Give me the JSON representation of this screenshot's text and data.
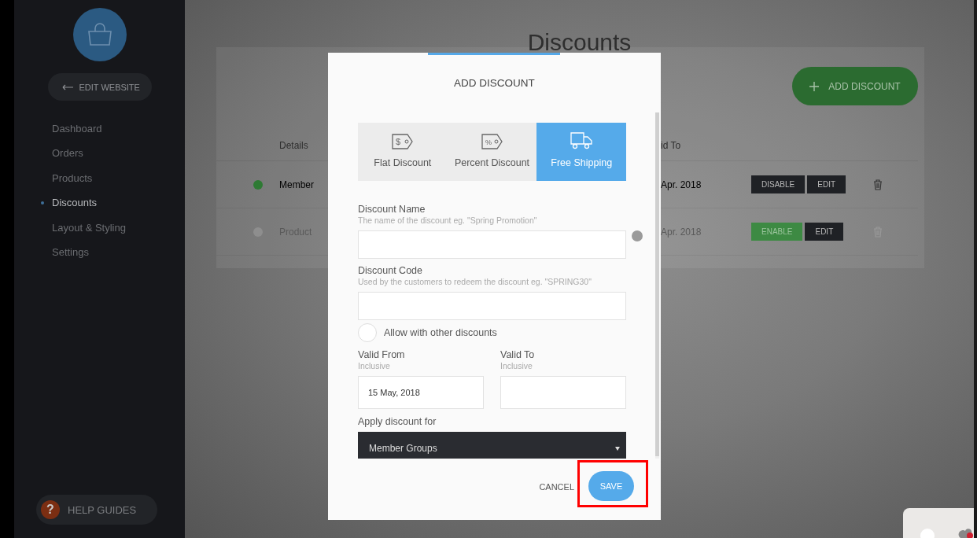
{
  "sidebar": {
    "edit_button": {
      "label": "EDIT WEBSITE"
    },
    "items": [
      {
        "label": "Dashboard",
        "selected": false
      },
      {
        "label": "Orders",
        "selected": false
      },
      {
        "label": "Products",
        "selected": false
      },
      {
        "label": "Discounts",
        "selected": true
      },
      {
        "label": "Layout & Styling",
        "selected": false
      },
      {
        "label": "Settings",
        "selected": false
      }
    ],
    "help": {
      "icon": "?",
      "label": "HELP GUIDES"
    }
  },
  "page": {
    "title": "Discounts",
    "add_button": {
      "label": "ADD DISCOUNT"
    },
    "columns": [
      "Details",
      "id To"
    ],
    "rows": [
      {
        "enabled": true,
        "details": "Member",
        "valid_to": "Apr. 2018",
        "toggle": "DISABLE",
        "edit": "EDIT"
      },
      {
        "enabled": false,
        "details": "Product",
        "valid_to": "Apr. 2018",
        "toggle": "ENABLE",
        "edit": "EDIT"
      }
    ]
  },
  "dialog": {
    "title": "ADD DISCOUNT",
    "types": [
      {
        "kind": "flat",
        "symbol": "$",
        "label": "Flat Discount",
        "selected": false
      },
      {
        "kind": "percent",
        "symbol": "%",
        "label": "Percent Discount",
        "selected": false
      },
      {
        "kind": "shipping",
        "label": "Free Shipping",
        "selected": true
      }
    ],
    "name_field": {
      "label": "Discount Name",
      "hint": "The name of the discount eg. \"Spring Promotion\""
    },
    "code_field": {
      "label": "Discount Code",
      "hint": "Used by the customers to redeem the discount eg. \"SPRING30\""
    },
    "allow_other": {
      "label": "Allow with other discounts",
      "checked": false
    },
    "valid_from": {
      "label": "Valid From",
      "hint": "Inclusive",
      "value": "15 May, 2018"
    },
    "valid_to": {
      "label": "Valid To",
      "hint": "Inclusive"
    },
    "apply_for": {
      "label": "Apply discount for",
      "value": "Member Groups"
    },
    "cancel": {
      "label": "CANCEL"
    },
    "save": {
      "label": "SAVE",
      "highlighted": true
    }
  }
}
